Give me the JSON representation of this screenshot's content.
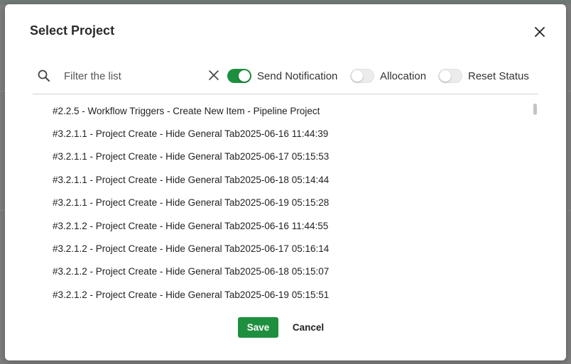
{
  "modal": {
    "title": "Select Project"
  },
  "toolbar": {
    "filter_placeholder": "Filter the list",
    "filter_value": "",
    "toggles": [
      {
        "label": "Send Notification",
        "on": true
      },
      {
        "label": "Allocation",
        "on": false
      },
      {
        "label": "Reset Status",
        "on": false
      }
    ]
  },
  "projects": [
    "#2.2.5 - Workflow Triggers - Create New Item - Pipeline Project",
    "#3.2.1.1 - Project Create - Hide General Tab2025-06-16 11:44:39",
    "#3.2.1.1 - Project Create - Hide General Tab2025-06-17 05:15:53",
    "#3.2.1.1 - Project Create - Hide General Tab2025-06-18 05:14:44",
    "#3.2.1.1 - Project Create - Hide General Tab2025-06-19 05:15:28",
    "#3.2.1.2 - Project Create - Hide General Tab2025-06-16 11:44:55",
    "#3.2.1.2 - Project Create - Hide General Tab2025-06-17 05:16:14",
    "#3.2.1.2 - Project Create - Hide General Tab2025-06-18 05:15:07",
    "#3.2.1.2 - Project Create - Hide General Tab2025-06-19 05:15:51"
  ],
  "footer": {
    "save_label": "Save",
    "cancel_label": "Cancel"
  },
  "colors": {
    "accent": "#1e8f3e",
    "overlay": "#7d7d7d"
  }
}
